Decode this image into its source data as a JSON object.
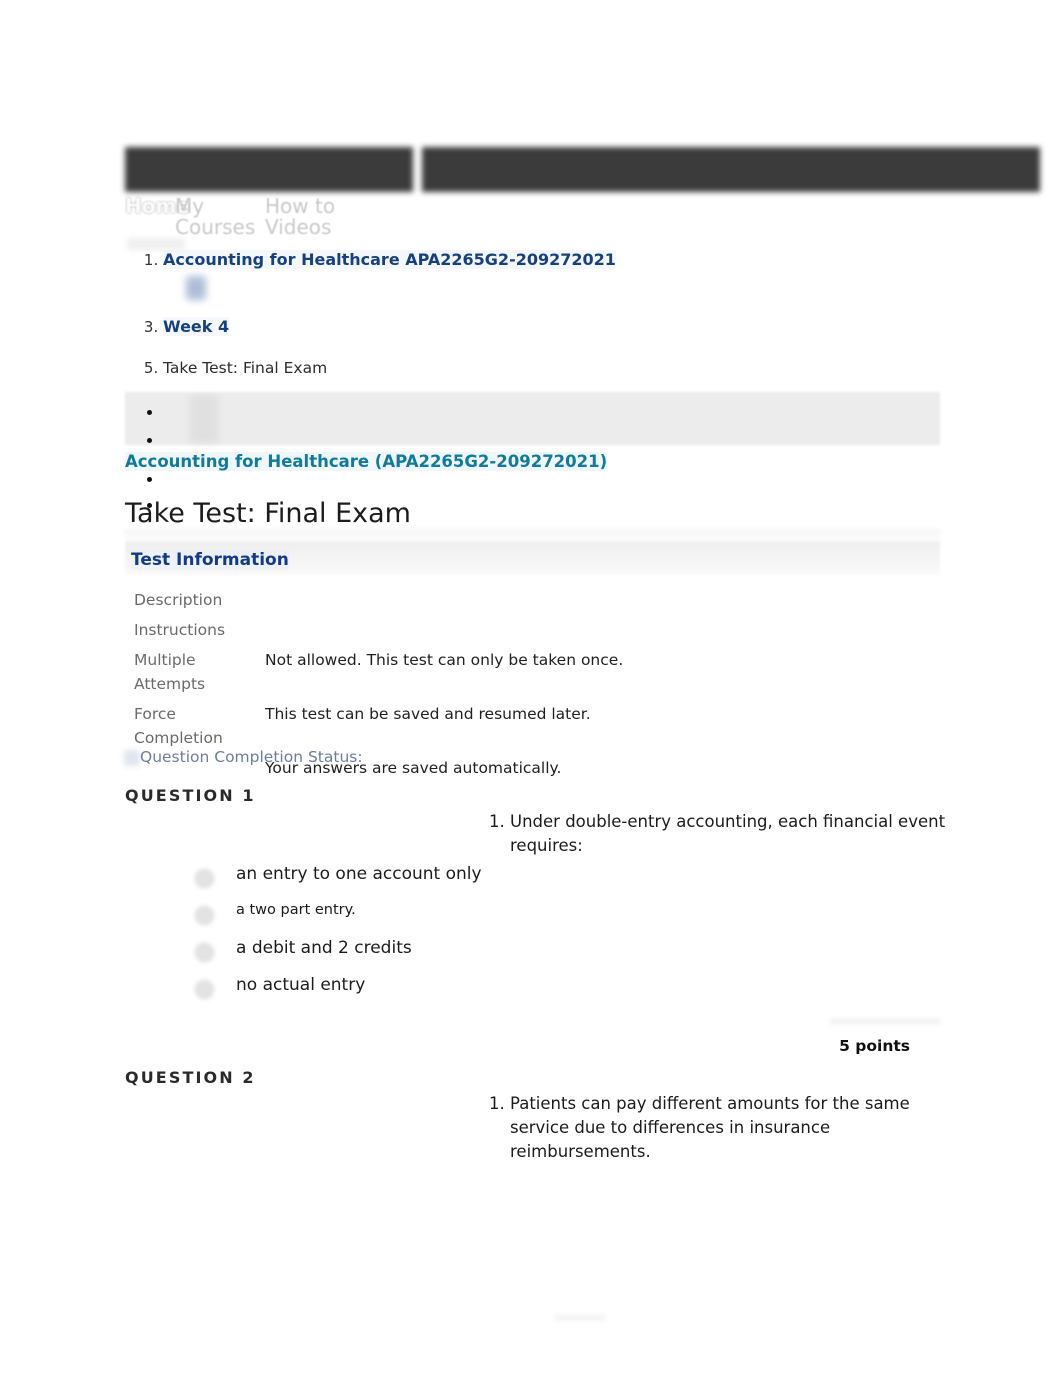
{
  "nav": {
    "home": "Home",
    "my_courses": "My Courses",
    "how_to_videos": "How to Videos"
  },
  "breadcrumb": {
    "items": [
      {
        "label": "Accounting for Healthcare APA2265G2-209272021",
        "link": true
      },
      {
        "label": "Week 4",
        "link": true
      },
      {
        "label": "Take Test: Final Exam",
        "link": false
      }
    ]
  },
  "course": {
    "title_link": "Accounting for Healthcare (APA2265G2-209272021)"
  },
  "page": {
    "heading": "Take Test: Final Exam"
  },
  "test_information": {
    "section_title": "Test Information",
    "rows": [
      {
        "label": "Description",
        "value": ""
      },
      {
        "label": "Instructions",
        "value": ""
      },
      {
        "label": "Multiple Attempts",
        "value": "Not allowed. This test can only be taken once."
      },
      {
        "label": "Force Completion",
        "value": "This test can be saved and resumed later."
      },
      {
        "label": "",
        "value": "Your answers are saved automatically."
      }
    ]
  },
  "question_completion_status": "Question Completion Status:",
  "questions": [
    {
      "label": "QUESTION 1",
      "stem": "Under double-entry accounting, each financial event requires:",
      "options": [
        {
          "text": "an entry to one account only",
          "small": false
        },
        {
          "text": "a two part entry.",
          "small": true
        },
        {
          "text": "a debit and 2 credits",
          "small": false
        },
        {
          "text": "no actual entry",
          "small": false
        }
      ],
      "points": "5 points"
    },
    {
      "label": "QUESTION 2",
      "stem": "Patients can pay different amounts for the same service due to differences in insurance reimbursements.",
      "options": [],
      "points": ""
    }
  ],
  "colors": {
    "navbar": "#3b3b3b",
    "breadcrumb_link": "#17417e",
    "course_link": "#127a9b",
    "section_title": "#123a87",
    "status_text": "#6b7e9e",
    "band_gray": "#ececec"
  }
}
